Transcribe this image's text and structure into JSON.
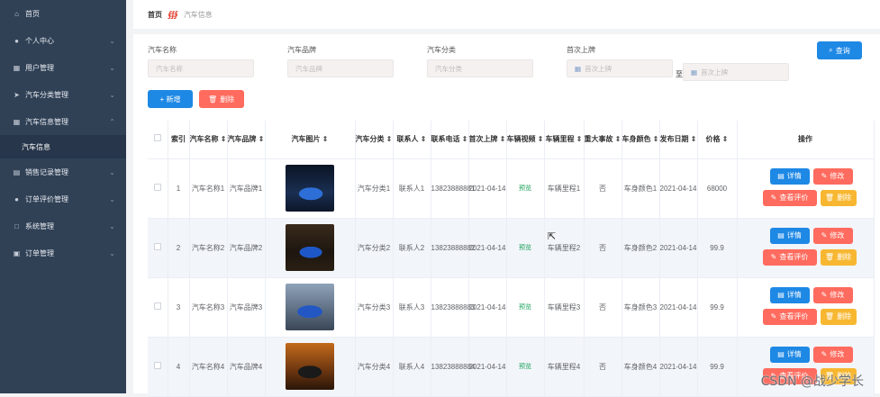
{
  "sidebar": {
    "items": [
      {
        "icon": "home-icon",
        "glyph": "⌂",
        "label": "首页",
        "chevron": false
      },
      {
        "icon": "user-icon",
        "glyph": "●",
        "label": "个人中心",
        "chevron": true
      },
      {
        "icon": "users-icon",
        "glyph": "▦",
        "label": "用户管理",
        "chevron": true
      },
      {
        "icon": "send-icon",
        "glyph": "➤",
        "label": "汽车分类管理",
        "chevron": true
      },
      {
        "icon": "grid-icon",
        "glyph": "▦",
        "label": "汽车信息管理",
        "chevron": true,
        "open": true
      }
    ],
    "sub_item": "汽车信息",
    "items2": [
      {
        "icon": "record-icon",
        "glyph": "▤",
        "label": "销售记录管理"
      },
      {
        "icon": "user-icon",
        "glyph": "●",
        "label": "订单评价管理"
      },
      {
        "icon": "system-icon",
        "glyph": "□",
        "label": "系统管理"
      },
      {
        "icon": "order-icon",
        "glyph": "▣",
        "label": "订单管理"
      }
    ]
  },
  "breadcrumb": {
    "home": "首页",
    "sep": "∰",
    "current": "汽车信息"
  },
  "filters": {
    "name": {
      "label": "汽车名称",
      "placeholder": "汽车名称"
    },
    "brand": {
      "label": "汽车品牌",
      "placeholder": "汽车品牌"
    },
    "category": {
      "label": "汽车分类",
      "placeholder": "汽车分类"
    },
    "first_date": {
      "label": "首次上牌",
      "start": "首次上牌",
      "to": "至",
      "end": "首次上牌"
    },
    "search_label": "查询"
  },
  "actions": {
    "add": "+ 新增",
    "delete": "删除"
  },
  "table": {
    "headers": [
      "索引",
      "汽车名称",
      "汽车品牌",
      "汽车图片",
      "汽车分类",
      "联系人",
      "联系电话",
      "首次上牌",
      "车辆视频",
      "车辆里程",
      "重大事故",
      "车身颜色",
      "发布日期",
      "价格",
      "操作"
    ],
    "rows": [
      {
        "idx": "1",
        "name": "汽车名称1",
        "brand": "汽车品牌1",
        "cat": "汽车分类1",
        "contact": "联系人1",
        "phone": "13823888881",
        "first": "2021-04-14",
        "video": "预览",
        "mileage": "车辆里程1",
        "accident": "否",
        "color": "车身颜色1",
        "pub": "2021-04-14",
        "price": "68000"
      },
      {
        "idx": "2",
        "name": "汽车名称2",
        "brand": "汽车品牌2",
        "cat": "汽车分类2",
        "contact": "联系人2",
        "phone": "13823888882",
        "first": "2021-04-14",
        "video": "预览",
        "mileage": "车辆里程2",
        "accident": "否",
        "color": "车身颜色2",
        "pub": "2021-04-14",
        "price": "99.9"
      },
      {
        "idx": "3",
        "name": "汽车名称3",
        "brand": "汽车品牌3",
        "cat": "汽车分类3",
        "contact": "联系人3",
        "phone": "13823888883",
        "first": "2021-04-14",
        "video": "预览",
        "mileage": "车辆里程3",
        "accident": "否",
        "color": "车身颜色3",
        "pub": "2021-04-14",
        "price": "99.9"
      },
      {
        "idx": "4",
        "name": "汽车名称4",
        "brand": "汽车品牌4",
        "cat": "汽车分类4",
        "contact": "联系人4",
        "phone": "13823888884",
        "first": "2021-04-14",
        "video": "预览",
        "mileage": "车辆里程4",
        "accident": "否",
        "color": "车身颜色4",
        "pub": "2021-04-14",
        "price": "99.9"
      }
    ],
    "row_buttons": {
      "detail": "详情",
      "edit": "修改",
      "review": "查看评价",
      "delete": "删除"
    }
  },
  "watermark": "CSDN @战少学长",
  "colors": {
    "sidebar": "#304156",
    "primary": "#1e88e5",
    "danger": "#ff6b5e",
    "warning": "#f7b731"
  }
}
